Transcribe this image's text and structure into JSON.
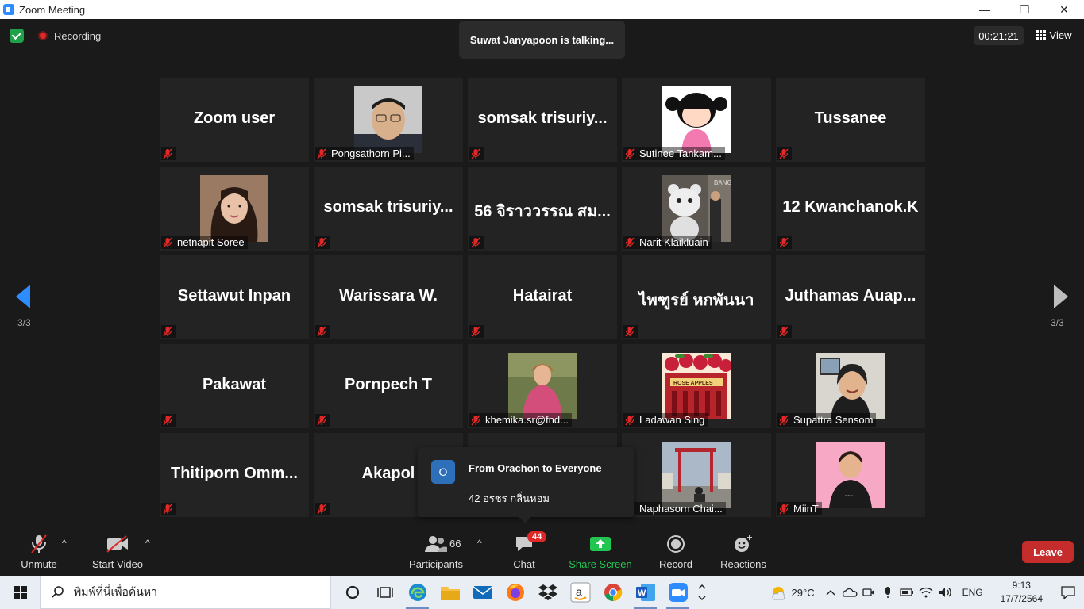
{
  "window": {
    "title": "Zoom Meeting",
    "minimize": "—",
    "restore": "❐",
    "close": "✕"
  },
  "topbar": {
    "recording_label": "Recording",
    "talking": "Suwat Janyapoon is talking...",
    "timer": "00:21:21",
    "view_label": "View"
  },
  "pagination": {
    "left": "3/3",
    "right": "3/3"
  },
  "tiles": [
    {
      "big": "Zoom user",
      "name": ""
    },
    {
      "big": "",
      "name": "Pongsathorn Pi...",
      "photo": "man-with-glasses"
    },
    {
      "big": "somsak  trisuriy...",
      "name": ""
    },
    {
      "big": "",
      "name": "Sutinee Tankam...",
      "photo": "cartoon-girl"
    },
    {
      "big": "Tussanee",
      "name": ""
    },
    {
      "big": "",
      "name": "netnapit Soree",
      "photo": "woman-long-hair"
    },
    {
      "big": "somsak  trisuriy...",
      "name": ""
    },
    {
      "big": "56 จิราววรรณ สม...",
      "name": ""
    },
    {
      "big": "",
      "name": "Narit Klaikluain",
      "photo": "bear-statue"
    },
    {
      "big": "12 Kwanchanok.K",
      "name": ""
    },
    {
      "big": "Settawut Inpan",
      "name": ""
    },
    {
      "big": "Warissara W.",
      "name": ""
    },
    {
      "big": "Hatairat",
      "name": ""
    },
    {
      "big": "ไพฑูรย์ หกพันนา",
      "name": ""
    },
    {
      "big": "Juthamas  Auap...",
      "name": ""
    },
    {
      "big": "Pakawat",
      "name": ""
    },
    {
      "big": "Pornpech T",
      "name": ""
    },
    {
      "big": "",
      "name": "khemika.sr@fnd...",
      "photo": "woman-pink-coat"
    },
    {
      "big": "",
      "name": "Ladawan Sing",
      "photo": "rose-apples"
    },
    {
      "big": "",
      "name": "Supattra Sensom",
      "photo": "woman-smiling"
    },
    {
      "big": "Thitiporn  Omm...",
      "name": ""
    },
    {
      "big": "Akapol",
      "name": ""
    },
    {
      "big": "",
      "name": ""
    },
    {
      "big": "",
      "name": "Naphasorn Chai...",
      "photo": "giant-swing"
    },
    {
      "big": "",
      "name": "MiinT",
      "photo": "person-pink-bg"
    }
  ],
  "chat_toast": {
    "avatar_letter": "O",
    "from": "From Orachon to Everyone",
    "message": "42 อรชร กลิ่นหอม"
  },
  "toolbar": {
    "unmute": "Unmute",
    "start_video": "Start Video",
    "participants": "Participants",
    "participants_count": "66",
    "chat": "Chat",
    "chat_badge": "44",
    "share_screen": "Share Screen",
    "record": "Record",
    "reactions": "Reactions",
    "leave": "Leave",
    "caret": "^"
  },
  "taskbar": {
    "search_placeholder": "พิมพ์ที่นี่เพื่อค้นหา",
    "temperature": "29°C",
    "language": "ENG",
    "time": "9:13",
    "date": "17/7/2564"
  },
  "colors": {
    "accent": "#2d8cff",
    "share": "#23c551",
    "leave": "#c52c2c",
    "badge": "#e02828",
    "mute": "#e02828"
  }
}
